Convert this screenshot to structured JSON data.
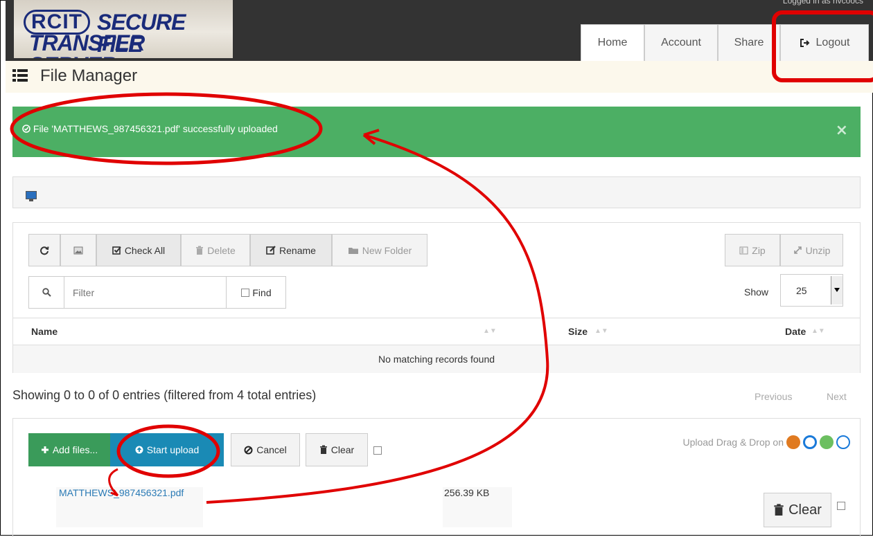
{
  "header": {
    "logo_line1": "RCIT",
    "logo_line1b": "SECURE FILE",
    "logo_line2": "TRANSFER SERVER",
    "logged_in": "Logged in as rivcoocs",
    "nav": [
      "Home",
      "Account",
      "Share",
      "Logout"
    ]
  },
  "page": {
    "title": "File Manager"
  },
  "alert": {
    "message": "File 'MATTHEWS_987456321.pdf' successfully uploaded",
    "close": "×"
  },
  "toolbar": {
    "check_all": "Check All",
    "delete": "Delete",
    "rename": "Rename",
    "new_folder": "New Folder",
    "zip": "Zip",
    "unzip": "Unzip"
  },
  "filter": {
    "placeholder": "Filter",
    "find": "Find",
    "show_label": "Show",
    "show_value": "25"
  },
  "table": {
    "columns": [
      "Name",
      "Size",
      "Date"
    ],
    "empty": "No matching records found",
    "summary": "Showing 0 to 0 of 0 entries (filtered from 4 total entries)",
    "previous": "Previous",
    "next": "Next"
  },
  "upload": {
    "add_files": "Add files...",
    "start_upload": "Start upload",
    "cancel": "Cancel",
    "clear": "Clear",
    "drag_drop": "Upload Drag & Drop on",
    "file_name": "MATTHEWS_987456321.pdf",
    "file_size": "256.39 KB",
    "row_clear": "Clear"
  },
  "colors": {
    "alert": "#4caf64",
    "add_files": "#3a9b5a",
    "start_upload": "#1a8ab5",
    "annotation": "#e00000"
  }
}
